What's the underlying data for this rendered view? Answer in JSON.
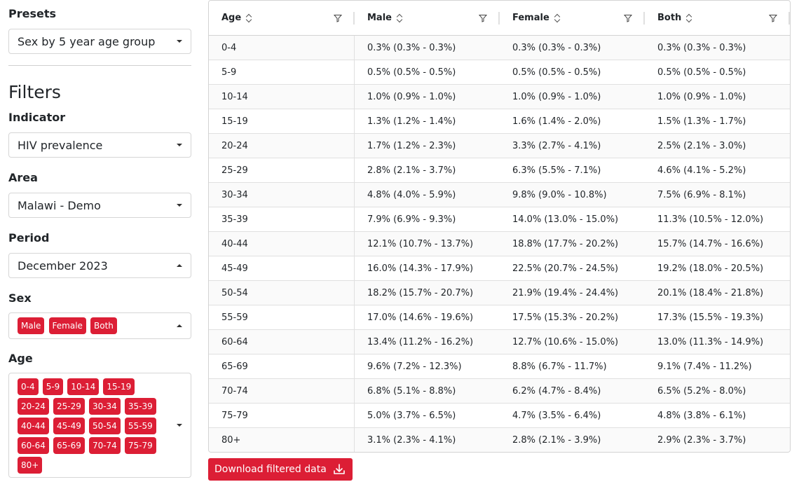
{
  "sidebar": {
    "presets_label": "Presets",
    "preset_value": "Sex by 5 year age group",
    "filters_heading": "Filters",
    "indicator_label": "Indicator",
    "indicator_value": "HIV prevalence",
    "area_label": "Area",
    "area_value": "Malawi - Demo",
    "period_label": "Period",
    "period_value": "December 2023",
    "sex_label": "Sex",
    "sex_chips": [
      "Male",
      "Female",
      "Both"
    ],
    "age_label": "Age",
    "age_chips": [
      "0-4",
      "5-9",
      "10-14",
      "15-19",
      "20-24",
      "25-29",
      "30-34",
      "35-39",
      "40-44",
      "45-49",
      "50-54",
      "55-59",
      "60-64",
      "65-69",
      "70-74",
      "75-79",
      "80+"
    ]
  },
  "table": {
    "headers": [
      "Age",
      "Male",
      "Female",
      "Both"
    ],
    "rows": [
      [
        "0-4",
        "0.3% (0.3% - 0.3%)",
        "0.3% (0.3% - 0.3%)",
        "0.3% (0.3% - 0.3%)"
      ],
      [
        "5-9",
        "0.5% (0.5% - 0.5%)",
        "0.5% (0.5% - 0.5%)",
        "0.5% (0.5% - 0.5%)"
      ],
      [
        "10-14",
        "1.0% (0.9% - 1.0%)",
        "1.0% (0.9% - 1.0%)",
        "1.0% (0.9% - 1.0%)"
      ],
      [
        "15-19",
        "1.3% (1.2% - 1.4%)",
        "1.6% (1.4% - 2.0%)",
        "1.5% (1.3% - 1.7%)"
      ],
      [
        "20-24",
        "1.7% (1.2% - 2.3%)",
        "3.3% (2.7% - 4.1%)",
        "2.5% (2.1% - 3.0%)"
      ],
      [
        "25-29",
        "2.8% (2.1% - 3.7%)",
        "6.3% (5.5% - 7.1%)",
        "4.6% (4.1% - 5.2%)"
      ],
      [
        "30-34",
        "4.8% (4.0% - 5.9%)",
        "9.8% (9.0% - 10.8%)",
        "7.5% (6.9% - 8.1%)"
      ],
      [
        "35-39",
        "7.9% (6.9% - 9.3%)",
        "14.0% (13.0% - 15.0%)",
        "11.3% (10.5% - 12.0%)"
      ],
      [
        "40-44",
        "12.1% (10.7% - 13.7%)",
        "18.8% (17.7% - 20.2%)",
        "15.7% (14.7% - 16.6%)"
      ],
      [
        "45-49",
        "16.0% (14.3% - 17.9%)",
        "22.5% (20.7% - 24.5%)",
        "19.2% (18.0% - 20.5%)"
      ],
      [
        "50-54",
        "18.2% (15.7% - 20.7%)",
        "21.9% (19.4% - 24.4%)",
        "20.1% (18.4% - 21.8%)"
      ],
      [
        "55-59",
        "17.0% (14.6% - 19.6%)",
        "17.5% (15.3% - 20.2%)",
        "17.3% (15.5% - 19.3%)"
      ],
      [
        "60-64",
        "13.4% (11.2% - 16.2%)",
        "12.7% (10.6% - 15.0%)",
        "13.0% (11.3% - 14.9%)"
      ],
      [
        "65-69",
        "9.6% (7.2% - 12.3%)",
        "8.8% (6.7% - 11.7%)",
        "9.1% (7.4% - 11.2%)"
      ],
      [
        "70-74",
        "6.8% (5.1% - 8.8%)",
        "6.2% (4.7% - 8.4%)",
        "6.5% (5.2% - 8.0%)"
      ],
      [
        "75-79",
        "5.0% (3.7% - 6.5%)",
        "4.7% (3.5% - 6.4%)",
        "4.8% (3.8% - 6.1%)"
      ],
      [
        "80+",
        "3.1% (2.3% - 4.1%)",
        "2.8% (2.1% - 3.9%)",
        "2.9% (2.3% - 3.7%)"
      ]
    ]
  },
  "download_label": "Download filtered data",
  "colors": {
    "accent": "#dc1e35"
  }
}
